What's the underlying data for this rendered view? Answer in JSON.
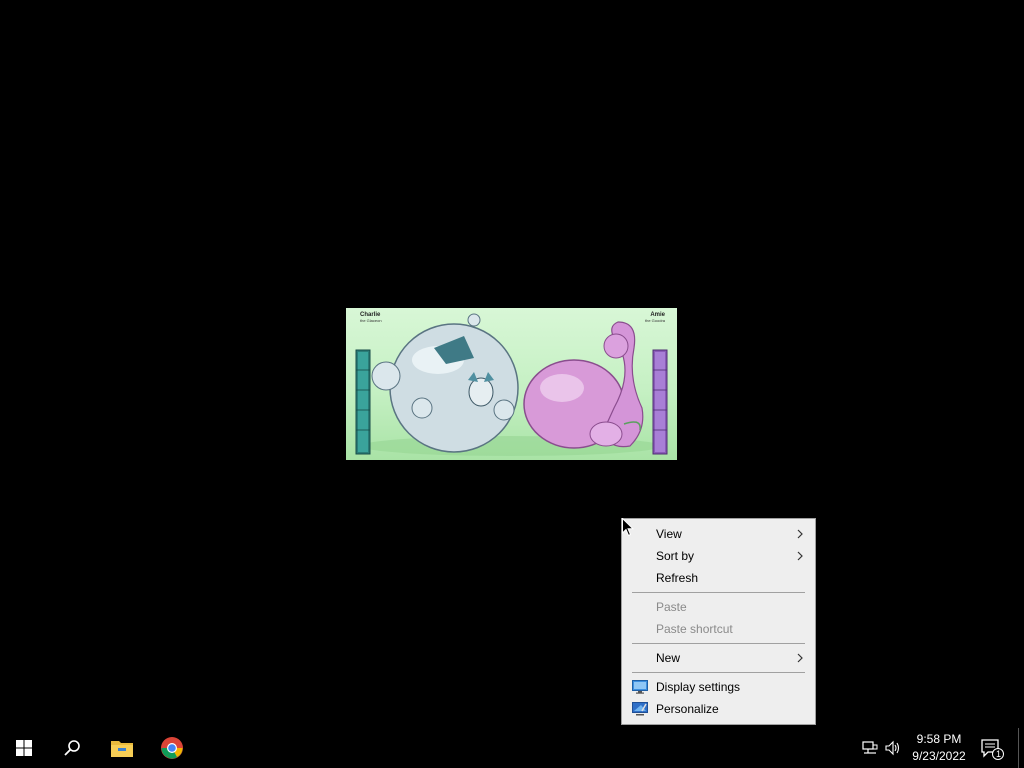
{
  "wallpaper": {
    "left_name": "Charlie",
    "left_sub": "the Glaceon",
    "right_name": "Amie",
    "right_sub": "the Goodra"
  },
  "context_menu": {
    "items": [
      {
        "label": "View",
        "enabled": true,
        "submenu": true
      },
      {
        "label": "Sort by",
        "enabled": true,
        "submenu": true
      },
      {
        "label": "Refresh",
        "enabled": true,
        "submenu": false
      },
      {
        "label": "Paste",
        "enabled": false,
        "submenu": false
      },
      {
        "label": "Paste shortcut",
        "enabled": false,
        "submenu": false
      },
      {
        "label": "New",
        "enabled": true,
        "submenu": true
      },
      {
        "label": "Display settings",
        "enabled": true,
        "icon": "display-icon"
      },
      {
        "label": "Personalize",
        "enabled": true,
        "icon": "personalize-icon"
      }
    ]
  },
  "taskbar": {
    "pinned": [
      {
        "name": "start-button",
        "icon": "windows-logo-icon"
      },
      {
        "name": "search-button",
        "icon": "search-icon"
      },
      {
        "name": "file-explorer-button",
        "icon": "folder-icon"
      },
      {
        "name": "chrome-button",
        "icon": "chrome-icon"
      }
    ],
    "tray": {
      "icons": [
        "network-icon",
        "volume-icon"
      ],
      "time": "9:58 PM",
      "date": "9/23/2022",
      "notification_count": "1"
    }
  },
  "colors": {
    "taskbar": "#000000",
    "menu_bg": "#eeeeee",
    "windows_blue": "#0a78d7",
    "disabled_text": "#8a8a8a"
  }
}
